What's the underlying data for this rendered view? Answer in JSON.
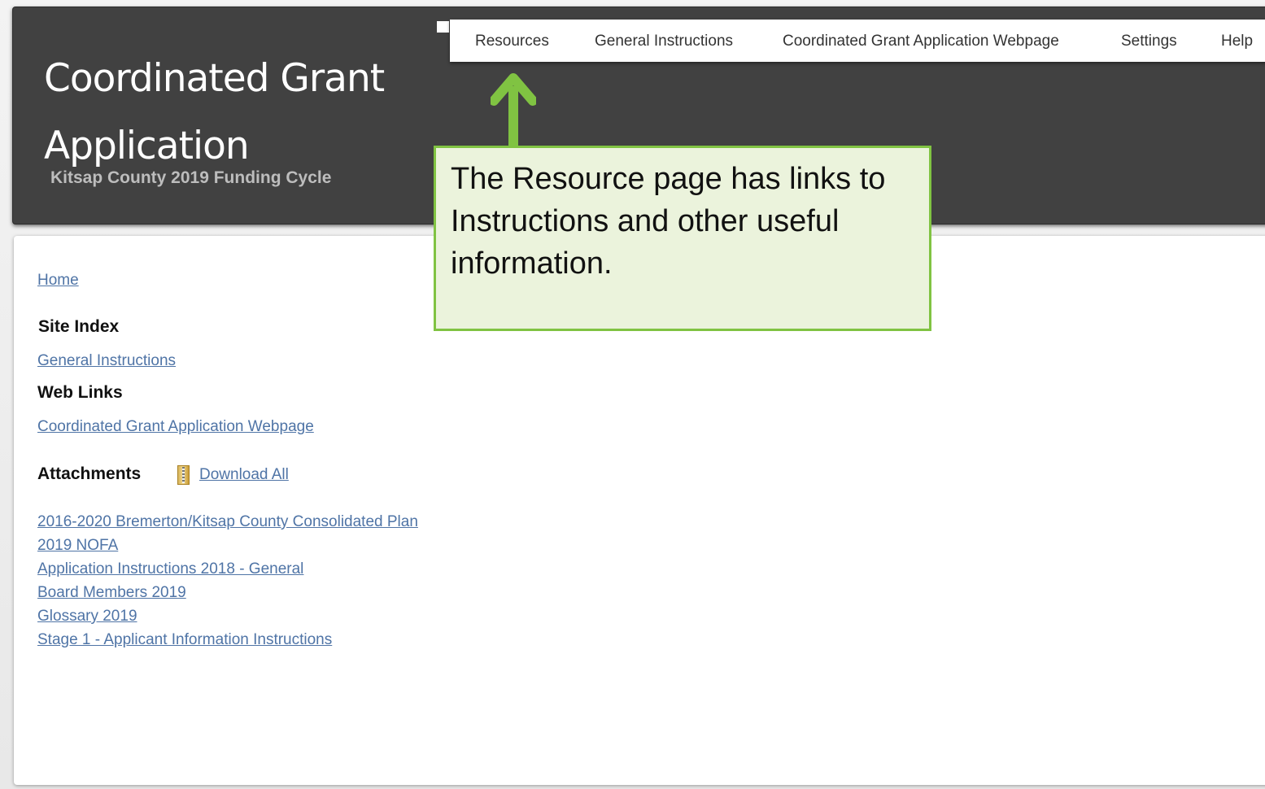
{
  "header": {
    "title": "Coordinated Grant Application",
    "subtitle": "Kitsap County 2019 Funding Cycle"
  },
  "nav": {
    "items": [
      {
        "label": "Resources"
      },
      {
        "label": "General Instructions"
      },
      {
        "label": "Coordinated Grant Application Webpage"
      },
      {
        "label": "Settings"
      },
      {
        "label": "Help"
      }
    ]
  },
  "content": {
    "home_link": "Home",
    "site_index": {
      "heading": "Site Index",
      "links": [
        "General Instructions"
      ]
    },
    "web_links": {
      "heading": "Web Links",
      "links": [
        "Coordinated Grant Application Webpage"
      ]
    },
    "attachments": {
      "heading": "Attachments",
      "download_all": "Download All",
      "files": [
        "2016-2020 Bremerton/Kitsap County Consolidated Plan",
        "2019 NOFA",
        "Application Instructions 2018 - General",
        "Board Members 2019",
        "Glossary 2019",
        "Stage 1 - Applicant Information Instructions"
      ]
    }
  },
  "callout": {
    "text": "The Resource page has links to Instructions and other useful information."
  },
  "colors": {
    "header_bg": "#414141",
    "link": "#4f74a6",
    "callout_border": "#80c342",
    "callout_bg": "#ebf3dc"
  }
}
